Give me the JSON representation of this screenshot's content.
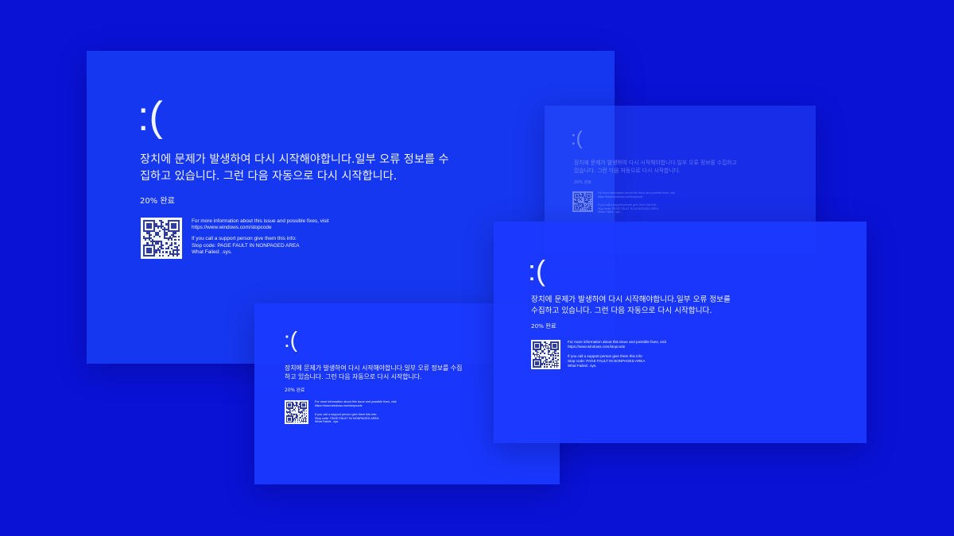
{
  "bsod": {
    "sad_face": ":(",
    "message": "장치에 문제가 발생하여 다시 시작해야합니다.일부 오류 정보를 수집하고 있습니다. 그런 다음 자동으로 다시 시작합니다.",
    "percent_label": "20% 완료",
    "info_line1": "For more information about this issue and possible fixes, visit",
    "info_url": "https://www.windows.com/stopcode",
    "info_line2": "If you call a support person give them this info:",
    "stop_code": "Stop code: PAGE FAULT IN  NONPAGED AREA",
    "what_failed": "What Failed: .sys."
  },
  "colors": {
    "background": "#0a12d6",
    "panel": "#1637f0",
    "text": "#eef2ff",
    "qr_dark": "#2f3c9e",
    "qr_light": "#f5f7ff"
  }
}
